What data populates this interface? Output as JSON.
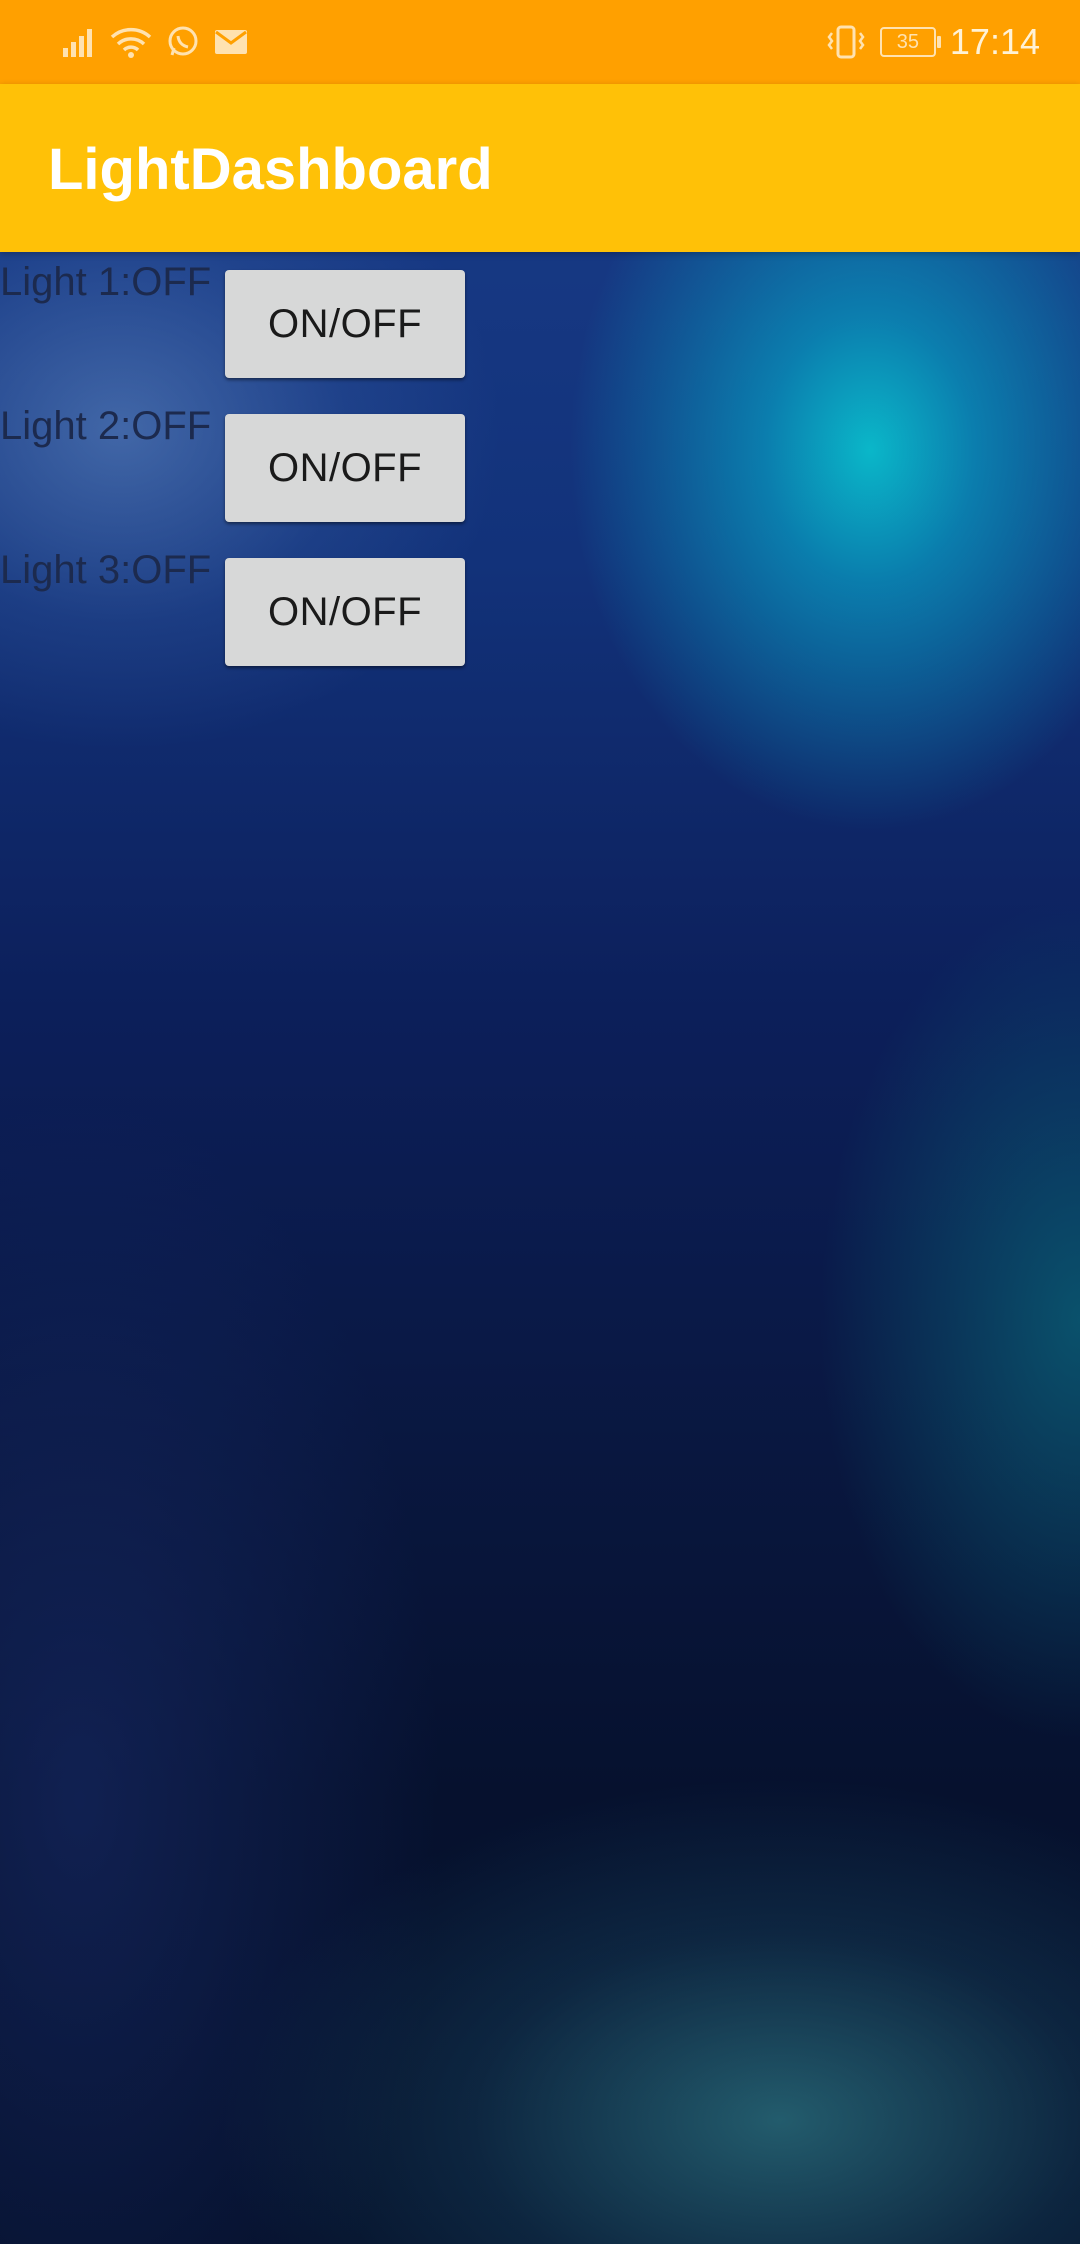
{
  "status_bar": {
    "icons": [
      "signal-icon",
      "wifi-icon",
      "whatsapp-icon",
      "mail-icon",
      "vibrate-icon",
      "battery-icon"
    ],
    "battery_level": "35",
    "time": "17:14"
  },
  "app_bar": {
    "title": "LightDashboard",
    "color": "#ffc107"
  },
  "lights": [
    {
      "label": "Light 1:OFF",
      "button_label": "ON/OFF"
    },
    {
      "label": "Light 2:OFF",
      "button_label": "ON/OFF"
    },
    {
      "label": "Light 3:OFF",
      "button_label": "ON/OFF"
    }
  ],
  "colors": {
    "status_bar": "#ffa000",
    "app_bar": "#ffc107",
    "button": "#d7d8d8"
  }
}
